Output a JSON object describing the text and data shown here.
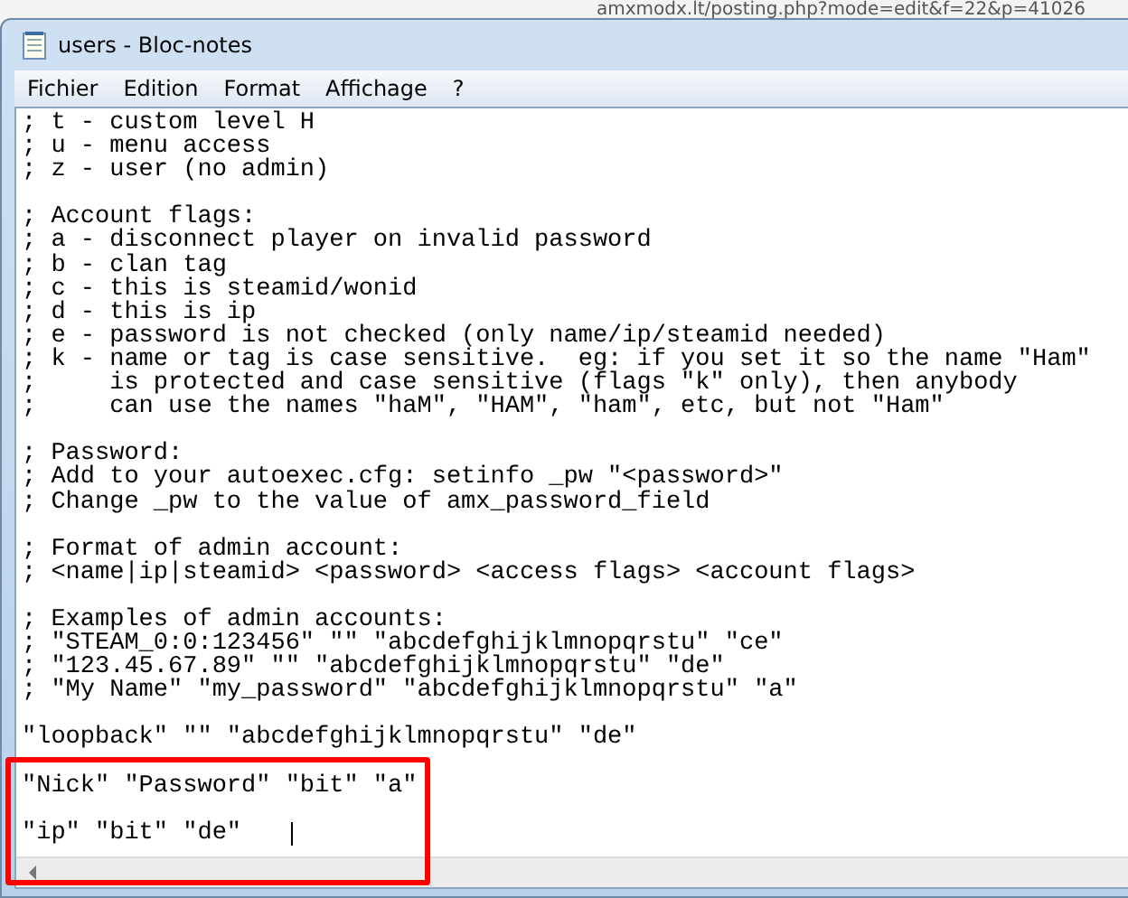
{
  "browser": {
    "address": "amxmodx.lt/posting.php?mode=edit&f=22&p=41026"
  },
  "window": {
    "title": "users - Bloc-notes"
  },
  "menu": [
    "Fichier",
    "Edition",
    "Format",
    "Affichage",
    "?"
  ],
  "editor": {
    "caret_visible": true,
    "blocks": [
      {
        "highlighted": false,
        "lines": [
          "; t - custom level H",
          "; u - menu access",
          "; z - user (no admin)"
        ]
      },
      {
        "highlighted": false,
        "lines": [
          "; Account flags:",
          "; a - disconnect player on invalid password",
          "; b - clan tag",
          "; c - this is steamid/wonid",
          "; d - this is ip",
          "; e - password is not checked (only name/ip/steamid needed)",
          "; k - name or tag is case sensitive.  eg: if you set it so the name \"Ham\"",
          ";     is protected and case sensitive (flags \"k\" only), then anybody",
          ";     can use the names \"haM\", \"HAM\", \"ham\", etc, but not \"Ham\""
        ]
      },
      {
        "highlighted": false,
        "lines": [
          "; Password:",
          "; Add to your autoexec.cfg: setinfo _pw \"<password>\"",
          "; Change _pw to the value of amx_password_field"
        ]
      },
      {
        "highlighted": false,
        "lines": [
          "; Format of admin account:",
          "; <name|ip|steamid> <password> <access flags> <account flags>"
        ]
      },
      {
        "highlighted": false,
        "lines": [
          "; Examples of admin accounts:",
          "; \"STEAM_0:0:123456\" \"\" \"abcdefghijklmnopqrstu\" \"ce\"",
          "; \"123.45.67.89\" \"\" \"abcdefghijklmnopqrstu\" \"de\"",
          "; \"My Name\" \"my_password\" \"abcdefghijklmnopqrstu\" \"a\""
        ]
      },
      {
        "highlighted": false,
        "lines": [
          "\"loopback\" \"\" \"abcdefghijklmnopqrstu\" \"de\""
        ]
      },
      {
        "highlighted": true,
        "lines": [
          "\"Nick\" \"Password\" \"bit\" \"a\""
        ]
      },
      {
        "highlighted": true,
        "lines": [
          "\"ip\" \"bit\" \"de\""
        ]
      }
    ]
  }
}
